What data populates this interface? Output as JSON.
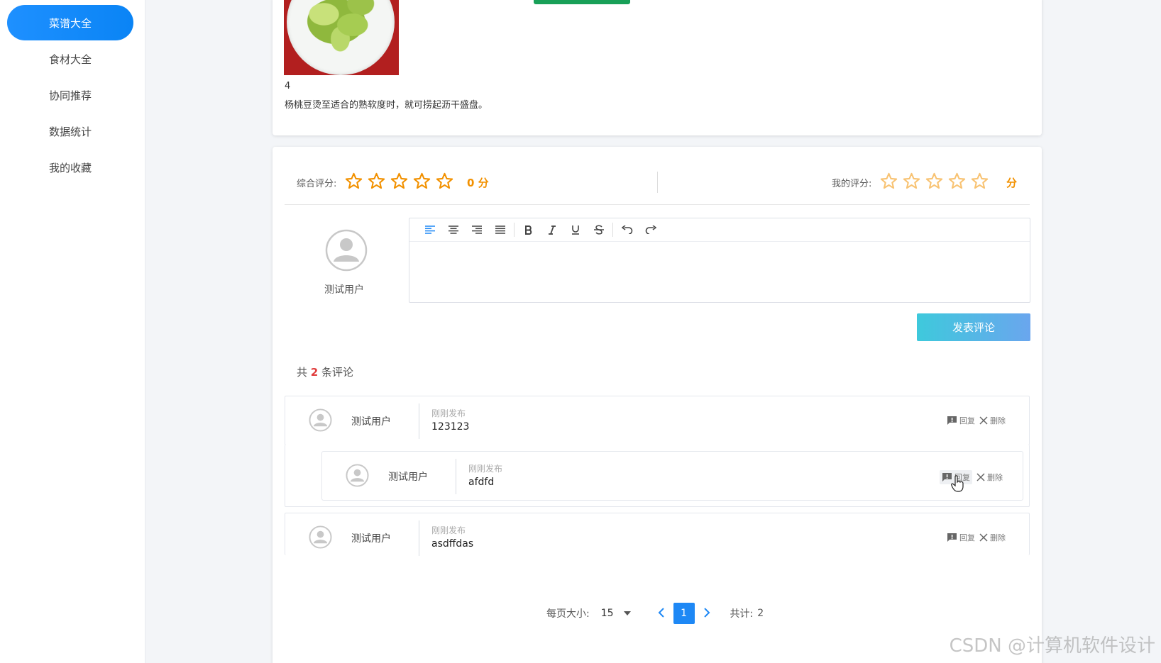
{
  "sidebar": {
    "items": [
      {
        "label": "菜谱大全",
        "active": true
      },
      {
        "label": "食材大全"
      },
      {
        "label": "协同推荐"
      },
      {
        "label": "数据统计"
      },
      {
        "label": "我的收藏"
      }
    ]
  },
  "step": {
    "number": "4",
    "text": "杨桃豆烫至适合的熟软度时，就可捞起沥干盛盘。"
  },
  "rating": {
    "overall_label": "综合评分:",
    "overall_score": "0 分",
    "overall_stars": 0,
    "mine_label": "我的评分:",
    "mine_score": "分",
    "mine_stars": 0,
    "star_color": "#f29100"
  },
  "editor": {
    "user_name": "测试用户",
    "toolbar_icons": [
      "align-left-icon",
      "align-center-icon",
      "align-right-icon",
      "align-justify-icon",
      "bold-icon",
      "italic-icon",
      "underline-icon",
      "strikethrough-icon",
      "undo-icon",
      "redo-icon"
    ],
    "submit_label": "发表评论"
  },
  "comments": {
    "count_prefix": "共",
    "count": "2",
    "count_suffix": "条评论",
    "items": [
      {
        "user": "测试用户",
        "time": "刚刚发布",
        "text": "123123",
        "reply": "回复",
        "delete": "删除"
      },
      {
        "user": "测试用户",
        "time": "刚刚发布",
        "text": "afdfd",
        "reply": "回复",
        "delete": "删除"
      },
      {
        "user": "测试用户",
        "time": "刚刚发布",
        "text": "asdffdas",
        "reply": "回复",
        "delete": "删除"
      }
    ]
  },
  "pagination": {
    "page_size_label": "每页大小:",
    "page_size": "15",
    "current_page": "1",
    "total_label": "共计:",
    "total": "2"
  },
  "watermark": "CSDN @计算机软件设计"
}
